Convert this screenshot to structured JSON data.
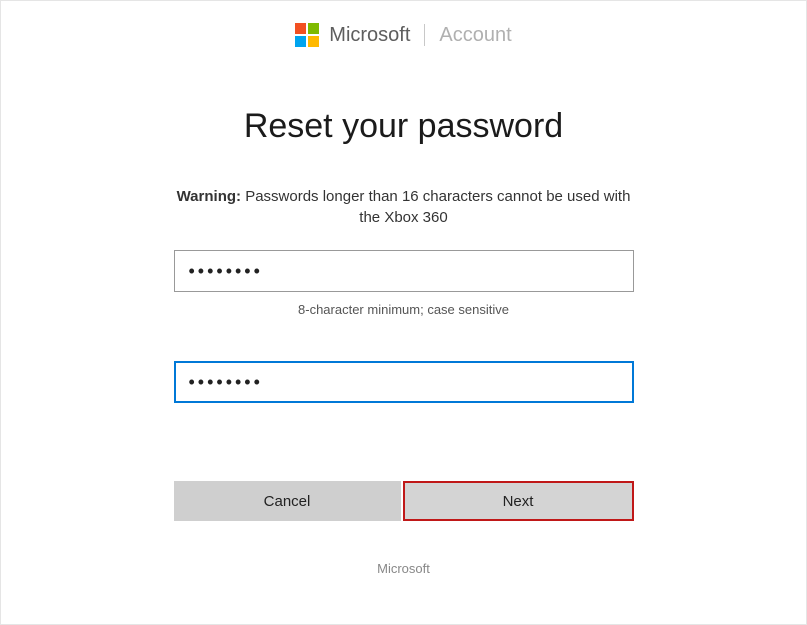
{
  "header": {
    "brand": "Microsoft",
    "section": "Account"
  },
  "main": {
    "title": "Reset your password",
    "warning_bold": "Warning:",
    "warning_text": "Passwords longer than 16 characters cannot be used with the Xbox 360",
    "password1_value": "••••••••",
    "password_hint": "8-character minimum; case sensitive",
    "password2_value": "••••••••"
  },
  "buttons": {
    "cancel": "Cancel",
    "next": "Next"
  },
  "footer": {
    "text": "Microsoft"
  }
}
